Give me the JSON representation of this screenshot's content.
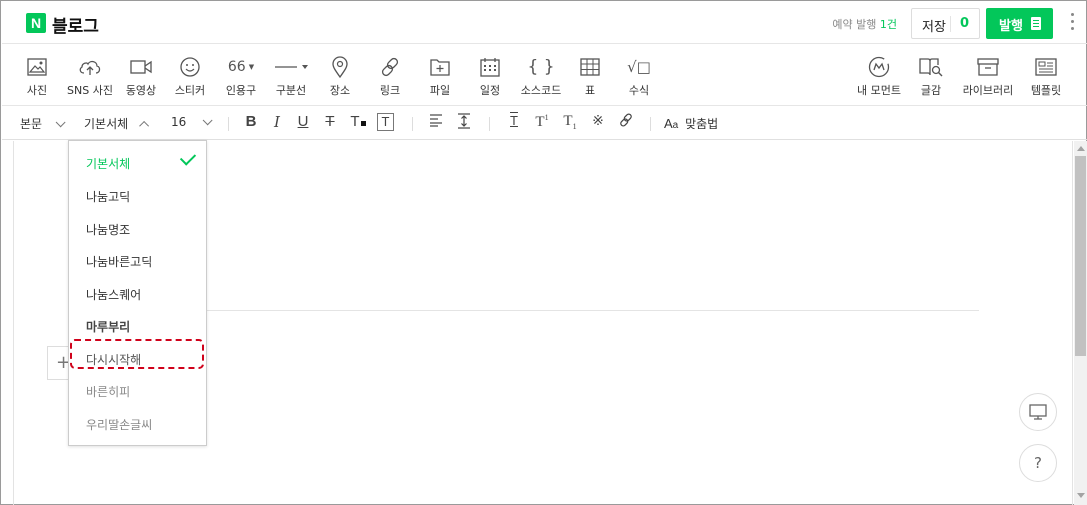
{
  "header": {
    "logo_letter": "N",
    "app_title": "블로그",
    "reserve_label": "예약 발행",
    "reserve_count": "1건",
    "save_label": "저장",
    "save_count": "0",
    "publish_label": "발행",
    "brand_color": "#03c75a"
  },
  "toolbar": {
    "left_items": [
      {
        "label": "사진",
        "icon": "photo-icon"
      },
      {
        "label": "SNS 사진",
        "icon": "cloud-upload-icon"
      },
      {
        "label": "동영상",
        "icon": "video-icon"
      },
      {
        "label": "스티커",
        "icon": "smiley-icon"
      },
      {
        "label": "인용구",
        "icon": "quote-icon",
        "glyph": "66"
      },
      {
        "label": "구분선",
        "icon": "divider-icon"
      },
      {
        "label": "장소",
        "icon": "map-pin-icon"
      },
      {
        "label": "링크",
        "icon": "link-icon"
      },
      {
        "label": "파일",
        "icon": "file-plus-icon"
      },
      {
        "label": "일정",
        "icon": "calendar-icon"
      },
      {
        "label": "소스코드",
        "icon": "code-braces-icon",
        "glyph": "{ }"
      },
      {
        "label": "표",
        "icon": "table-icon"
      },
      {
        "label": "수식",
        "icon": "formula-icon",
        "glyph": "√□"
      }
    ],
    "right_items": [
      {
        "label": "내 모먼트",
        "icon": "moment-icon"
      },
      {
        "label": "글감",
        "icon": "book-search-icon"
      },
      {
        "label": "라이브러리",
        "icon": "archive-icon"
      },
      {
        "label": "템플릿",
        "icon": "template-icon"
      }
    ]
  },
  "format_bar": {
    "paragraph_style": "본문",
    "font_family": "기본서체",
    "font_size": "16",
    "spellcheck_label": "맞춤법"
  },
  "font_dropdown": {
    "items": [
      {
        "label": "기본서체",
        "selected": true
      },
      {
        "label": "나눔고딕"
      },
      {
        "label": "나눔명조"
      },
      {
        "label": "나눔바른고딕"
      },
      {
        "label": "나눔스퀘어"
      },
      {
        "label": "마루부리"
      },
      {
        "label": "다시시작해"
      },
      {
        "label": "바른히피"
      },
      {
        "label": "우리딸손글씨"
      }
    ],
    "highlighted": "다시시작해",
    "highlight_color": "#d0021b"
  },
  "side_buttons": {
    "help_glyph": "?"
  }
}
